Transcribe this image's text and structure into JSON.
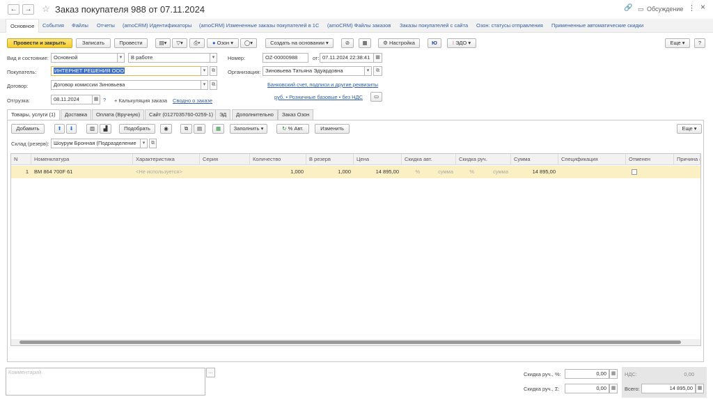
{
  "window": {
    "title": "Заказ покупателя 988 от 07.11.2024",
    "discussion": "Обсуждение",
    "back": "←",
    "forward": "→",
    "star": "☆",
    "link": "🔗",
    "more": "⋮",
    "close": "×"
  },
  "nav_links": [
    "Основное",
    "События",
    "Файлы",
    "Отчеты",
    "(amoCRM) Идентификаторы",
    "(amoCRM) Измененные заказы покупателей в 1С",
    "(amoCRM) Файлы заказов",
    "Заказы покупателей с сайта",
    "Озон: статусы отправления",
    "Примененные автоматические скидки"
  ],
  "toolbar": {
    "post_close": "Провести и закрыть",
    "save": "Записать",
    "post": "Провести",
    "ozon": "Озон",
    "create_based": "Создать на основании",
    "settings": "Настройка",
    "edo": "ЭДО",
    "more": "Еще",
    "help": "?"
  },
  "form": {
    "kind_label": "Вид и состояние:",
    "kind": "Основной",
    "state": "В работе",
    "number_label": "Номер:",
    "number": "OZ-00000988",
    "date_label": "от:",
    "date": "07.11.2024 22:38:41",
    "buyer_label": "Покупатель:",
    "buyer": "ИНТЕРНЕТ РЕШЕНИЯ ООО",
    "org_label": "Организация:",
    "org": "Зиновьева Татьяна Эдуардовна",
    "contract_label": "Договор:",
    "contract": "Договор комиссии Зиновьева",
    "bank_link": "Банковский счет, подписи и другие реквизиты",
    "price_link": "руб. • Розничные базовые • без НДС",
    "ship_label": "Отгрузка:",
    "ship_date": "08.11.2024",
    "help": "?",
    "calc_link": "+ Калькуляция заказа",
    "summary_link": "Сводно о заказе"
  },
  "tabs": [
    "Товары, услуги (1)",
    "Доставка",
    "Оплата (Вручную)",
    "Сайт (0127035760-0259-1)",
    "ЭД",
    "Дополнительно",
    "Заказ Озон"
  ],
  "table_toolbar": {
    "add": "Добавить",
    "pick": "Подобрать",
    "fill": "Заполнить",
    "auto": "% Авт.",
    "change": "Изменить",
    "more": "Еще"
  },
  "warehouse": {
    "label": "Склад (резерв):",
    "value": "Шоурум Бронная (Подразделение"
  },
  "columns": [
    "N",
    "Номенклатура",
    "Характеристика",
    "Серия",
    "Количество",
    "В резерв",
    "Цена",
    "Скидка авт.",
    "Скидка руч.",
    "Сумма",
    "Спецификация",
    "Отменен",
    "Причина о"
  ],
  "rows": [
    {
      "n": "1",
      "item": "BM 864 700F 61",
      "char": "<Не используется>",
      "series": "",
      "qty": "1,000",
      "reserve": "1,000",
      "price": "14 895,00",
      "disc_auto_pct": "%",
      "disc_auto_sum": "сумма",
      "disc_man_pct": "%",
      "disc_man_sum": "сумма",
      "sum": "14 895,00",
      "spec": ""
    }
  ],
  "footer": {
    "comment_placeholder": "Комментарий",
    "disc_pct_label": "Скидка руч., %:",
    "disc_pct": "0,00",
    "disc_sum_label": "Скидка руч., Σ:",
    "disc_sum": "0,00",
    "vat_label": "НДС:",
    "vat": "0,00",
    "total_label": "Всего:",
    "total": "14 895,00"
  }
}
